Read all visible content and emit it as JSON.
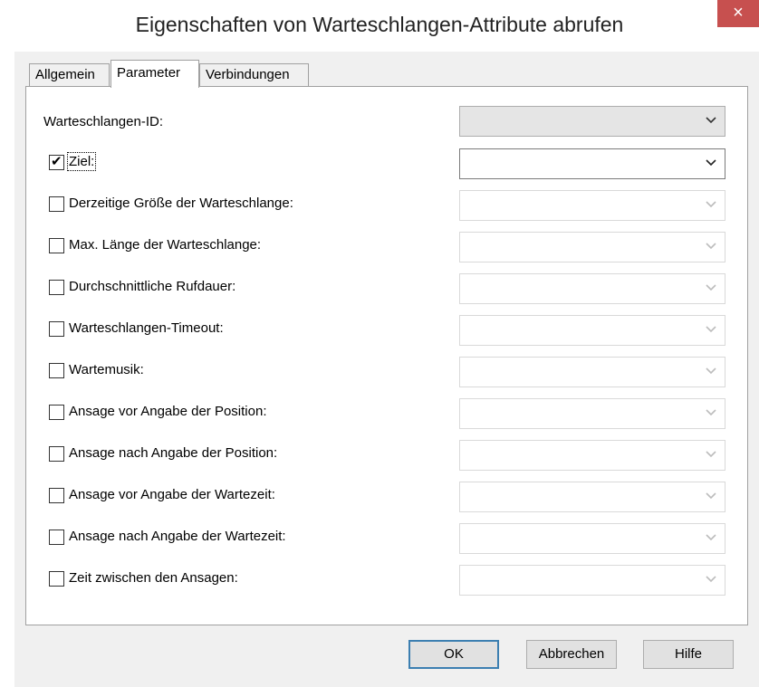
{
  "window": {
    "title": "Eigenschaften von Warteschlangen-Attribute abrufen",
    "close_label": "×"
  },
  "tabs": [
    {
      "label": "Allgemein",
      "active": false
    },
    {
      "label": "Parameter",
      "active": true
    },
    {
      "label": "Verbindungen",
      "active": false
    }
  ],
  "queue_id": {
    "label": "Warteschlangen-ID:",
    "value": ""
  },
  "options": [
    {
      "label": "Ziel:",
      "checked": true,
      "value": ""
    },
    {
      "label": "Derzeitige Größe der Warteschlange:",
      "checked": false,
      "value": ""
    },
    {
      "label": "Max. Länge der Warteschlange:",
      "checked": false,
      "value": ""
    },
    {
      "label": "Durchschnittliche Rufdauer:",
      "checked": false,
      "value": ""
    },
    {
      "label": "Warteschlangen-Timeout:",
      "checked": false,
      "value": ""
    },
    {
      "label": "Wartemusik:",
      "checked": false,
      "value": ""
    },
    {
      "label": "Ansage vor  Angabe der Position:",
      "checked": false,
      "value": ""
    },
    {
      "label": "Ansage nach Angabe der Position:",
      "checked": false,
      "value": ""
    },
    {
      "label": "Ansage vor Angabe der Wartezeit:",
      "checked": false,
      "value": ""
    },
    {
      "label": "Ansage nach Angabe der Wartezeit:",
      "checked": false,
      "value": ""
    },
    {
      "label": "Zeit zwischen den Ansagen:",
      "checked": false,
      "value": ""
    }
  ],
  "buttons": {
    "ok": "OK",
    "cancel": "Abbrechen",
    "help": "Hilfe"
  },
  "icons": {
    "close": "close-icon",
    "chevron": "chevron-down-icon",
    "check": "checkmark-icon"
  },
  "colors": {
    "close_button": "#c7504f",
    "default_button_border": "#3c7fb1",
    "disabled_border": "#d9d9d9"
  }
}
